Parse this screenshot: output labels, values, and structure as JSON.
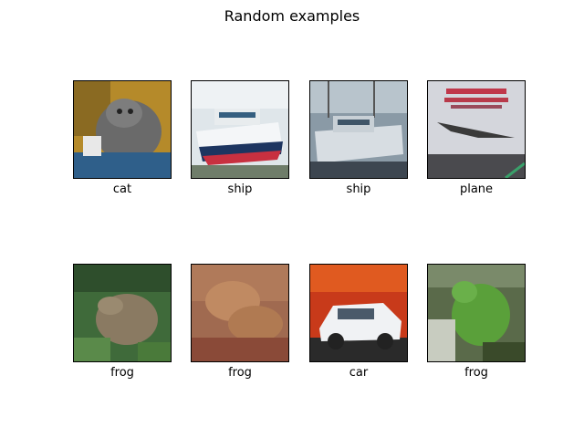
{
  "figure": {
    "title": "Random examples"
  },
  "examples": [
    {
      "label": "cat",
      "icon": "cat-image"
    },
    {
      "label": "ship",
      "icon": "ship-image"
    },
    {
      "label": "ship",
      "icon": "ship-image"
    },
    {
      "label": "plane",
      "icon": "plane-image"
    },
    {
      "label": "frog",
      "icon": "frog-image"
    },
    {
      "label": "frog",
      "icon": "frog-image"
    },
    {
      "label": "car",
      "icon": "car-image"
    },
    {
      "label": "frog",
      "icon": "frog-image"
    }
  ]
}
